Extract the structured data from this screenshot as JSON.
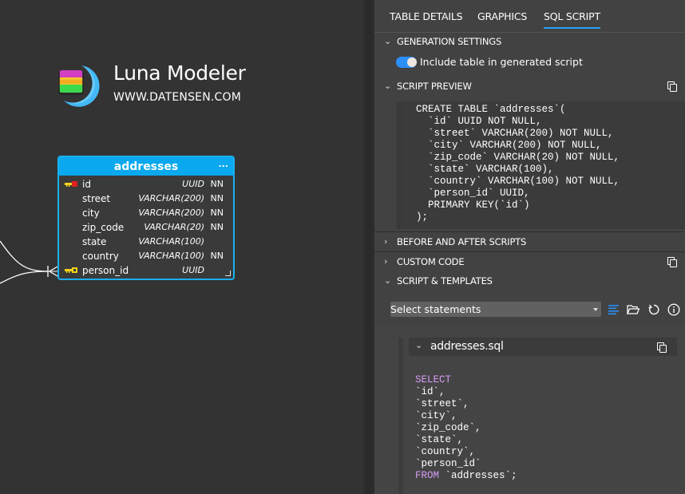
{
  "brand": {
    "title": "Luna Modeler",
    "url": "WWW.DATENSEN.COM",
    "logo_icon": "stacked-database-moon-logo"
  },
  "entity": {
    "name": "addresses",
    "menu_label": "...",
    "columns": [
      {
        "name": "id",
        "type": "UUID",
        "nn": "NN",
        "key": "primary-key"
      },
      {
        "name": "street",
        "type": "VARCHAR(200)",
        "nn": "NN",
        "key": ""
      },
      {
        "name": "city",
        "type": "VARCHAR(200)",
        "nn": "NN",
        "key": ""
      },
      {
        "name": "zip_code",
        "type": "VARCHAR(20)",
        "nn": "NN",
        "key": ""
      },
      {
        "name": "state",
        "type": "VARCHAR(100)",
        "nn": "",
        "key": ""
      },
      {
        "name": "country",
        "type": "VARCHAR(100)",
        "nn": "NN",
        "key": ""
      },
      {
        "name": "person_id",
        "type": "UUID",
        "nn": "",
        "key": "foreign-key"
      }
    ]
  },
  "panel": {
    "tabs": [
      {
        "label": "TABLE DETAILS",
        "active": false
      },
      {
        "label": "GRAPHICS",
        "active": false
      },
      {
        "label": "SQL SCRIPT",
        "active": true
      }
    ],
    "sections": {
      "generation_settings": {
        "label": "GENERATION SETTINGS",
        "expanded": true
      },
      "include_toggle": {
        "label": "Include table in generated script",
        "on": true
      },
      "script_preview": {
        "label": "SCRIPT PREVIEW",
        "expanded": true
      },
      "before_after": {
        "label": "BEFORE AND AFTER SCRIPTS",
        "expanded": false
      },
      "custom_code": {
        "label": "CUSTOM CODE",
        "expanded": false
      },
      "script_templates": {
        "label": "SCRIPT & TEMPLATES",
        "expanded": true
      }
    },
    "script_preview_code": "CREATE TABLE `addresses`(\n  `id` UUID NOT NULL,\n  `street` VARCHAR(200) NOT NULL,\n  `city` VARCHAR(200) NOT NULL,\n  `zip_code` VARCHAR(20) NOT NULL,\n  `state` VARCHAR(100),\n  `country` VARCHAR(100) NOT NULL,\n  `person_id` UUID,\n  PRIMARY KEY(`id`)\n);",
    "select": {
      "value": "Select statements"
    },
    "template_file": {
      "name": "addresses.sql",
      "code_lines": [
        {
          "kw": "SELECT",
          "text": ""
        },
        {
          "kw": "",
          "text": "`id`,"
        },
        {
          "kw": "",
          "text": "`street`,"
        },
        {
          "kw": "",
          "text": "`city`,"
        },
        {
          "kw": "",
          "text": "`zip_code`,"
        },
        {
          "kw": "",
          "text": "`state`,"
        },
        {
          "kw": "",
          "text": "`country`,"
        },
        {
          "kw": "",
          "text": "`person_id`"
        },
        {
          "kw": "FROM",
          "text": " `addresses`;"
        }
      ]
    }
  },
  "colors": {
    "accent": "#2a9ff7",
    "entity_header": "#0aa8ee",
    "keyword": "#d69cf5"
  }
}
